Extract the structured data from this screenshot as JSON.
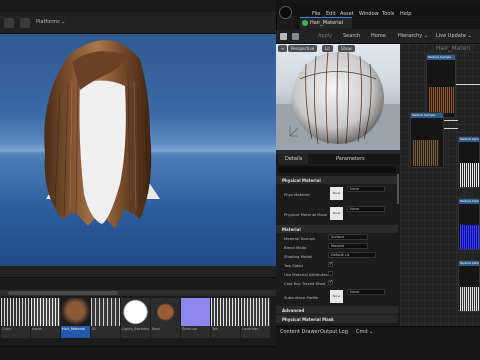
{
  "level_editor": {
    "toolbar": {
      "platforms_label": "Platforms ⌄"
    }
  },
  "content_browser": {
    "items": [
      {
        "label": "Color"
      },
      {
        "label": "depth"
      },
      {
        "label": "Hair_Material"
      },
      {
        "label": "ID"
      },
      {
        "label": "Lights_Backdrop"
      },
      {
        "label": "Root"
      },
      {
        "label": "Specular"
      },
      {
        "label": "Tan"
      },
      {
        "label": "Lavender"
      }
    ],
    "bottom_buttons": {
      "drawer": "Content Drawer",
      "output": "Output Log",
      "cmd": "Cmd ⌄"
    }
  },
  "material_editor": {
    "menu": [
      "File",
      "Edit",
      "Asset",
      "Window",
      "Tools",
      "Help"
    ],
    "tab_title": "Hair_Material",
    "toolbar": {
      "apply": "Apply",
      "search": "Search",
      "home": "Home",
      "hierarchy": "Hierarchy ⌄",
      "live_update": "Live Update ⌄"
    },
    "preview": {
      "perspective": "Perspective",
      "lit": "Lit",
      "show": "Show"
    },
    "details": {
      "tab_details": "Details",
      "tab_parameters": "Parameters",
      "sections": {
        "physical_material": "Physical Material",
        "material": "Material",
        "advanced": "Advanced",
        "physical_material_mask": "Physical Material Mask"
      },
      "properties": {
        "phys_material": "Phys Material",
        "phys_material_mask": "Physical Material Mask",
        "material_domain": "Material Domain",
        "blend_mode": "Blend Mode",
        "shading_model": "Shading Model",
        "two_sided": "Two Sided",
        "use_material_attributes": "Use Material Attributes",
        "cast_ray_traced_shadows": "Cast Ray Traced Shad",
        "subsurface_profile": "Subsurface Profile"
      },
      "values": {
        "none": "None",
        "material_domain": "Surface",
        "blend_mode": "Masked",
        "shading_model": "Default Lit"
      },
      "checks": {
        "two_sided": true,
        "use_material_attributes": false,
        "cast_ray_traced_shadows": true
      }
    },
    "graph": {
      "title": "Hair_Materi",
      "node_labels": [
        "Texture Sample",
        "Texture Sample",
        "Texture Sample",
        "Texture Sample",
        "Texture Sample",
        "Texture Sample"
      ],
      "pin_label": "Apply View MipBias"
    }
  }
}
